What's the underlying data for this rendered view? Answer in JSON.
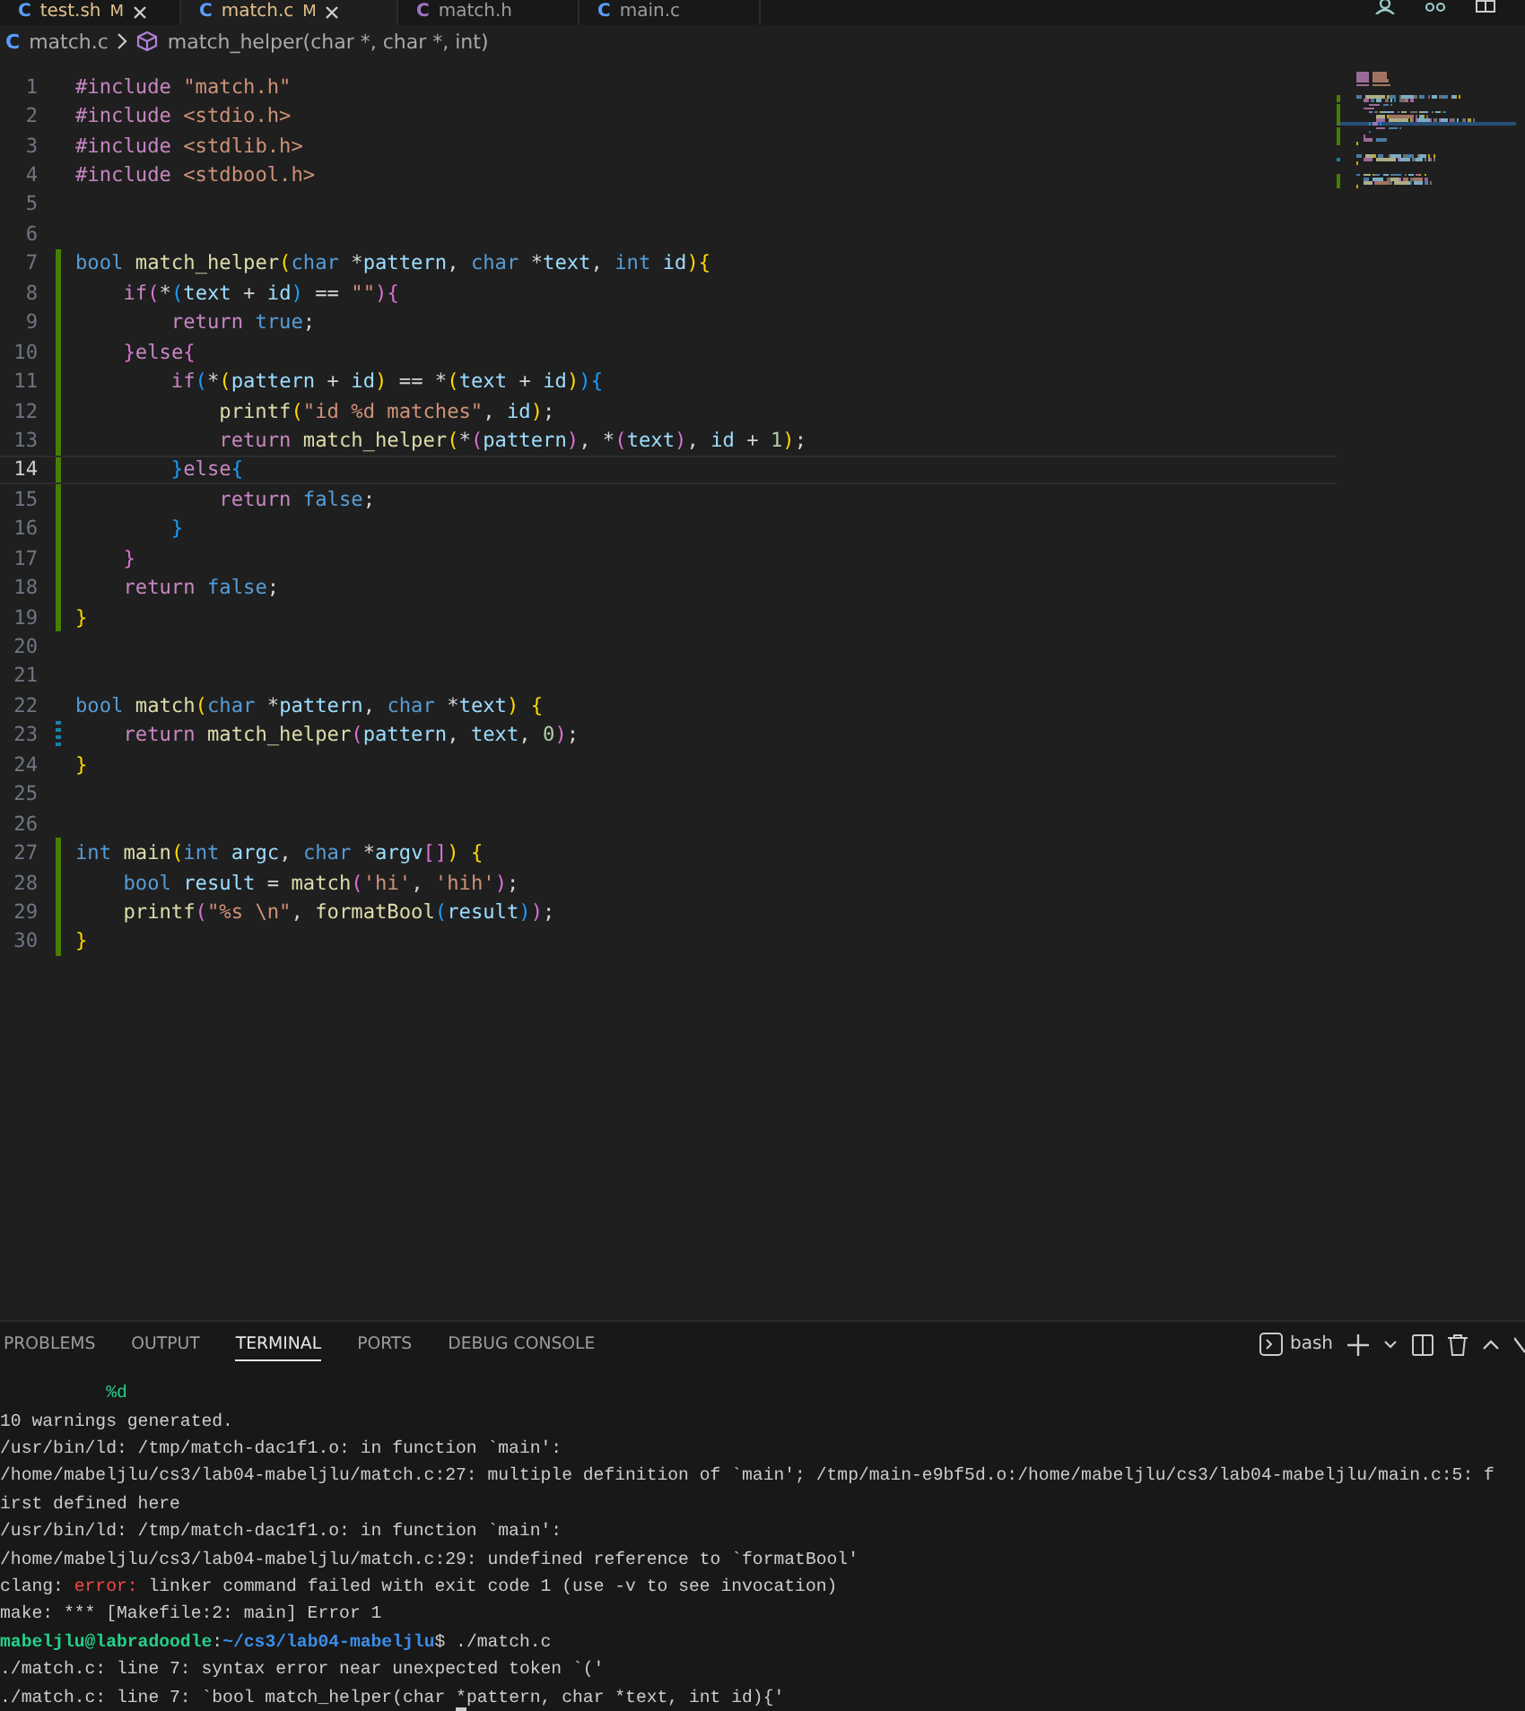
{
  "editor_tabs": [
    {
      "icon_glyph": "C",
      "label": "test.sh",
      "badge": "M",
      "selected": false,
      "closable": true
    },
    {
      "icon_glyph": "C",
      "label": "match.c",
      "badge": "M",
      "selected": true,
      "closable": true
    },
    {
      "icon_glyph": "C",
      "label": "match.h",
      "selected": false,
      "closable": false
    },
    {
      "icon_glyph": "C",
      "label": "main.c",
      "selected": false,
      "closable": false
    }
  ],
  "breadcrumb": {
    "icon_glyph": "C",
    "file": "match.c",
    "symbol": "match_helper(char *, char *, int)"
  },
  "code_lines": [
    {
      "number": "1",
      "added": false,
      "modified": false,
      "tokens": [
        {
          "kind": "pp",
          "text": "#include"
        },
        {
          "kind": "str",
          "text": " \"match.h\""
        }
      ]
    },
    {
      "number": "2",
      "added": false,
      "modified": false,
      "tokens": [
        {
          "kind": "pp",
          "text": "#include"
        },
        {
          "kind": "str",
          "text": " <stdio.h>"
        }
      ]
    },
    {
      "number": "3",
      "added": false,
      "modified": false,
      "tokens": [
        {
          "kind": "pp",
          "text": "#include"
        },
        {
          "kind": "str",
          "text": " <stdlib.h>"
        }
      ]
    },
    {
      "number": "4",
      "added": false,
      "modified": false,
      "tokens": [
        {
          "kind": "pp",
          "text": "#include"
        },
        {
          "kind": "str",
          "text": " <stdbool.h>"
        }
      ]
    },
    {
      "number": "5",
      "added": false,
      "modified": false
    },
    {
      "number": "6",
      "added": false,
      "modified": false
    },
    {
      "number": "7",
      "added": true,
      "modified": false,
      "tokens": [
        {
          "kind": "type",
          "text": "bool"
        },
        {
          "kind": "fn",
          "text": " match_helper"
        },
        {
          "kind": "b1",
          "text": "("
        },
        {
          "kind": "type",
          "text": "char"
        },
        {
          "kind": "op",
          "text": " *"
        },
        {
          "kind": "var",
          "text": "pattern"
        },
        {
          "kind": "op",
          "text": ", "
        },
        {
          "kind": "type",
          "text": "char"
        },
        {
          "kind": "op",
          "text": " *"
        },
        {
          "kind": "var",
          "text": "text"
        },
        {
          "kind": "op",
          "text": ", "
        },
        {
          "kind": "type",
          "text": "int"
        },
        {
          "kind": "var",
          "text": " id"
        },
        {
          "kind": "b1",
          "text": ")"
        },
        {
          "kind": "b1",
          "text": "{"
        }
      ]
    },
    {
      "number": "8",
      "added": true,
      "modified": false,
      "tokens": [
        {
          "kind": "ctl",
          "text": "    if"
        },
        {
          "kind": "b2",
          "text": "("
        },
        {
          "kind": "op",
          "text": "*"
        },
        {
          "kind": "b3",
          "text": "("
        },
        {
          "kind": "var",
          "text": "text"
        },
        {
          "kind": "op",
          "text": " + "
        },
        {
          "kind": "var",
          "text": "id"
        },
        {
          "kind": "b3",
          "text": ")"
        },
        {
          "kind": "op",
          "text": " == "
        },
        {
          "kind": "str",
          "text": "\"\""
        },
        {
          "kind": "b2",
          "text": ")"
        },
        {
          "kind": "b2",
          "text": "{"
        }
      ]
    },
    {
      "number": "9",
      "added": true,
      "modified": false,
      "tokens": [
        {
          "kind": "ctl",
          "text": "        return"
        },
        {
          "kind": "const",
          "text": " true"
        },
        {
          "kind": "op",
          "text": ";"
        }
      ]
    },
    {
      "number": "10",
      "added": true,
      "modified": false,
      "tokens": [
        {
          "kind": "b2",
          "text": "    }"
        },
        {
          "kind": "ctl",
          "text": "else"
        },
        {
          "kind": "b2",
          "text": "{"
        }
      ]
    },
    {
      "number": "11",
      "added": true,
      "modified": false,
      "tokens": [
        {
          "kind": "ctl",
          "text": "        if"
        },
        {
          "kind": "b3",
          "text": "("
        },
        {
          "kind": "op",
          "text": "*"
        },
        {
          "kind": "b1",
          "text": "("
        },
        {
          "kind": "var",
          "text": "pattern"
        },
        {
          "kind": "op",
          "text": " + "
        },
        {
          "kind": "var",
          "text": "id"
        },
        {
          "kind": "b1",
          "text": ")"
        },
        {
          "kind": "op",
          "text": " == *"
        },
        {
          "kind": "b1",
          "text": "("
        },
        {
          "kind": "var",
          "text": "text"
        },
        {
          "kind": "op",
          "text": " + "
        },
        {
          "kind": "var",
          "text": "id"
        },
        {
          "kind": "b1",
          "text": ")"
        },
        {
          "kind": "b3",
          "text": ")"
        },
        {
          "kind": "b3",
          "text": "{"
        }
      ]
    },
    {
      "number": "12",
      "added": true,
      "modified": false,
      "tokens": [
        {
          "kind": "fn",
          "text": "            printf"
        },
        {
          "kind": "b1",
          "text": "("
        },
        {
          "kind": "str",
          "text": "\"id %d matches\""
        },
        {
          "kind": "op",
          "text": ", "
        },
        {
          "kind": "var",
          "text": "id"
        },
        {
          "kind": "b1",
          "text": ")"
        },
        {
          "kind": "op",
          "text": ";"
        }
      ]
    },
    {
      "number": "13",
      "added": true,
      "modified": false,
      "tokens": [
        {
          "kind": "ctl",
          "text": "            return"
        },
        {
          "kind": "fn",
          "text": " match_helper"
        },
        {
          "kind": "b1",
          "text": "("
        },
        {
          "kind": "op",
          "text": "*"
        },
        {
          "kind": "b2",
          "text": "("
        },
        {
          "kind": "var",
          "text": "pattern"
        },
        {
          "kind": "b2",
          "text": ")"
        },
        {
          "kind": "op",
          "text": ", *"
        },
        {
          "kind": "b2",
          "text": "("
        },
        {
          "kind": "var",
          "text": "text"
        },
        {
          "kind": "b2",
          "text": ")"
        },
        {
          "kind": "op",
          "text": ", "
        },
        {
          "kind": "var",
          "text": "id"
        },
        {
          "kind": "op",
          "text": " + "
        },
        {
          "kind": "num",
          "text": "1"
        },
        {
          "kind": "b1",
          "text": ")"
        },
        {
          "kind": "op",
          "text": ";"
        }
      ]
    },
    {
      "number": "14",
      "added": true,
      "modified": false,
      "selected": true,
      "tokens": [
        {
          "kind": "b3",
          "text": "        }"
        },
        {
          "kind": "ctl",
          "text": "else"
        },
        {
          "kind": "b3",
          "text": "{"
        }
      ]
    },
    {
      "number": "15",
      "added": true,
      "modified": false,
      "tokens": [
        {
          "kind": "ctl",
          "text": "            return"
        },
        {
          "kind": "const",
          "text": " false"
        },
        {
          "kind": "op",
          "text": ";"
        }
      ]
    },
    {
      "number": "16",
      "added": true,
      "modified": false,
      "tokens": [
        {
          "kind": "b3",
          "text": "        }"
        }
      ]
    },
    {
      "number": "17",
      "added": true,
      "modified": false,
      "tokens": [
        {
          "kind": "b2",
          "text": "    }"
        }
      ]
    },
    {
      "number": "18",
      "added": true,
      "modified": false,
      "tokens": [
        {
          "kind": "ctl",
          "text": "    return"
        },
        {
          "kind": "const",
          "text": " false"
        },
        {
          "kind": "op",
          "text": ";"
        }
      ]
    },
    {
      "number": "19",
      "added": true,
      "modified": false,
      "tokens": [
        {
          "kind": "b1",
          "text": "}"
        }
      ]
    },
    {
      "number": "20",
      "added": false,
      "modified": false
    },
    {
      "number": "21",
      "added": false,
      "modified": false
    },
    {
      "number": "22",
      "added": false,
      "modified": false,
      "tokens": [
        {
          "kind": "type",
          "text": "bool"
        },
        {
          "kind": "fn",
          "text": " match"
        },
        {
          "kind": "b1",
          "text": "("
        },
        {
          "kind": "type",
          "text": "char"
        },
        {
          "kind": "op",
          "text": " *"
        },
        {
          "kind": "var",
          "text": "pattern"
        },
        {
          "kind": "op",
          "text": ", "
        },
        {
          "kind": "type",
          "text": "char"
        },
        {
          "kind": "op",
          "text": " *"
        },
        {
          "kind": "var",
          "text": "text"
        },
        {
          "kind": "b1",
          "text": ")"
        },
        {
          "kind": "b1",
          "text": " {"
        }
      ]
    },
    {
      "number": "23",
      "added": false,
      "modified": true,
      "tokens": [
        {
          "kind": "ctl",
          "text": "    return"
        },
        {
          "kind": "fn",
          "text": " match_helper"
        },
        {
          "kind": "b2",
          "text": "("
        },
        {
          "kind": "var",
          "text": "pattern"
        },
        {
          "kind": "op",
          "text": ", "
        },
        {
          "kind": "var",
          "text": "text"
        },
        {
          "kind": "op",
          "text": ", "
        },
        {
          "kind": "num",
          "text": "0"
        },
        {
          "kind": "b2",
          "text": ")"
        },
        {
          "kind": "op",
          "text": ";"
        }
      ]
    },
    {
      "number": "24",
      "added": false,
      "modified": false,
      "tokens": [
        {
          "kind": "b1",
          "text": "}"
        }
      ]
    },
    {
      "number": "25",
      "added": false,
      "modified": false
    },
    {
      "number": "26",
      "added": false,
      "modified": false
    },
    {
      "number": "27",
      "added": true,
      "modified": false,
      "tokens": [
        {
          "kind": "type",
          "text": "int"
        },
        {
          "kind": "fn",
          "text": " main"
        },
        {
          "kind": "b1",
          "text": "("
        },
        {
          "kind": "type",
          "text": "int"
        },
        {
          "kind": "var",
          "text": " argc"
        },
        {
          "kind": "op",
          "text": ", "
        },
        {
          "kind": "type",
          "text": "char"
        },
        {
          "kind": "op",
          "text": " *"
        },
        {
          "kind": "var",
          "text": "argv"
        },
        {
          "kind": "b2",
          "text": "[]"
        },
        {
          "kind": "b1",
          "text": ")"
        },
        {
          "kind": "b1",
          "text": " {"
        }
      ]
    },
    {
      "number": "28",
      "added": true,
      "modified": false,
      "tokens": [
        {
          "kind": "type",
          "text": "    bool"
        },
        {
          "kind": "var",
          "text": " result"
        },
        {
          "kind": "op",
          "text": " = "
        },
        {
          "kind": "fn",
          "text": "match"
        },
        {
          "kind": "b2",
          "text": "("
        },
        {
          "kind": "str",
          "text": "'hi'"
        },
        {
          "kind": "op",
          "text": ", "
        },
        {
          "kind": "str",
          "text": "'hih'"
        },
        {
          "kind": "b2",
          "text": ")"
        },
        {
          "kind": "op",
          "text": ";"
        }
      ]
    },
    {
      "number": "29",
      "added": true,
      "modified": false,
      "tokens": [
        {
          "kind": "fn",
          "text": "    printf"
        },
        {
          "kind": "b2",
          "text": "("
        },
        {
          "kind": "str",
          "text": "\"%s \\n\""
        },
        {
          "kind": "op",
          "text": ", "
        },
        {
          "kind": "fn",
          "text": "formatBool"
        },
        {
          "kind": "b3",
          "text": "("
        },
        {
          "kind": "var",
          "text": "result"
        },
        {
          "kind": "b3",
          "text": ")"
        },
        {
          "kind": "b2",
          "text": ")"
        },
        {
          "kind": "op",
          "text": ";"
        }
      ]
    },
    {
      "number": "30",
      "added": true,
      "modified": false,
      "tokens": [
        {
          "kind": "b1",
          "text": "}"
        }
      ]
    }
  ],
  "panel_tabs": [
    {
      "label": "PROBLEMS",
      "selected": false
    },
    {
      "label": "OUTPUT",
      "selected": false
    },
    {
      "label": "TERMINAL",
      "selected": true
    },
    {
      "label": "PORTS",
      "selected": false
    },
    {
      "label": "DEBUG CONSOLE",
      "selected": false
    }
  ],
  "terminal_name": "bash",
  "terminal_lines": [
    [
      {
        "kind": "ok",
        "text": "          %d"
      }
    ],
    [
      {
        "kind": "plain",
        "text": "10 warnings generated."
      }
    ],
    [
      {
        "kind": "plain",
        "text": "/usr/bin/ld: /tmp/match-dac1f1.o: in function `main':"
      }
    ],
    [
      {
        "kind": "plain",
        "text": "/home/mabeljlu/cs3/lab04-mabeljlu/match.c:27: multiple definition of `main'; /tmp/main-e9bf5d.o:/home/mabeljlu/cs3/lab04-mabeljlu/main.c:5: f"
      }
    ],
    [
      {
        "kind": "plain",
        "text": "irst defined here"
      }
    ],
    [
      {
        "kind": "plain",
        "text": "/usr/bin/ld: /tmp/match-dac1f1.o: in function `main':"
      }
    ],
    [
      {
        "kind": "plain",
        "text": "/home/mabeljlu/cs3/lab04-mabeljlu/match.c:29: undefined reference to `formatBool'"
      }
    ],
    [
      {
        "kind": "plain",
        "text": "clang: "
      },
      {
        "kind": "error",
        "text": "error:"
      },
      {
        "kind": "plain",
        "text": " linker command failed with exit code 1 (use -v to see invocation)"
      }
    ],
    [
      {
        "kind": "plain",
        "text": "make: *** [Makefile:2: main] Error 1"
      }
    ],
    [
      {
        "kind": "user",
        "text": "mabeljlu@labradoodle"
      },
      {
        "kind": "plain",
        "text": ":"
      },
      {
        "kind": "path",
        "text": "~/cs3/lab04-mabeljlu"
      },
      {
        "kind": "plain",
        "text": "$ ./match.c"
      }
    ],
    [
      {
        "kind": "plain",
        "text": "./match.c: line 7: syntax error near unexpected token `('"
      }
    ],
    [
      {
        "kind": "plain",
        "text": "./match.c: line 7: `bool match_helper(char "
      },
      {
        "kind": "cursor",
        "text": "*"
      },
      {
        "kind": "plain",
        "text": "pattern, char *text, int id){'"
      }
    ]
  ]
}
